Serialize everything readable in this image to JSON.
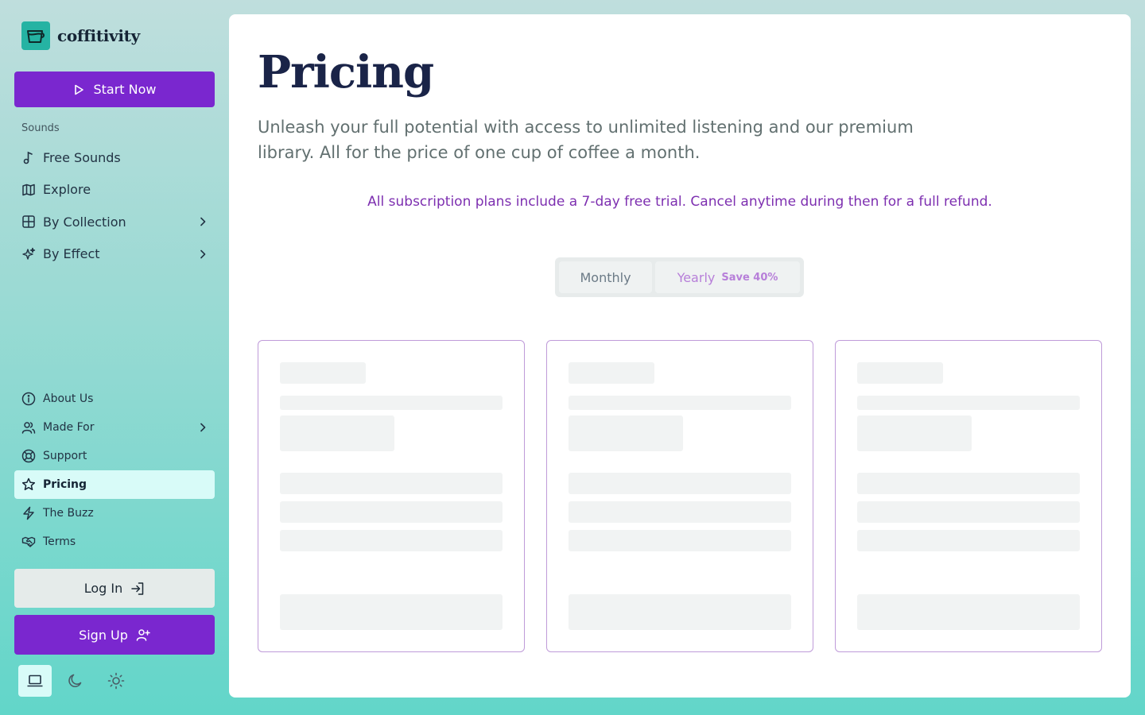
{
  "brand": {
    "name": "coffitivity",
    "logo_icon": "coffee-cup-icon"
  },
  "sidebar": {
    "start_button": "Start Now",
    "section_label": "Sounds",
    "top_items": [
      {
        "label": "Free Sounds",
        "icon": "music-note-icon"
      },
      {
        "label": "Explore",
        "icon": "map-icon"
      },
      {
        "label": "By Collection",
        "icon": "grid-icon"
      },
      {
        "label": "By Effect",
        "icon": "sparkles-icon"
      }
    ],
    "bottom_items": [
      {
        "label": "About Us",
        "icon": "info-icon"
      },
      {
        "label": "Made For",
        "icon": "users-icon"
      },
      {
        "label": "Support",
        "icon": "lifebuoy-icon"
      },
      {
        "label": "Pricing",
        "icon": "star-icon",
        "active": true
      },
      {
        "label": "The Buzz",
        "icon": "bolt-icon"
      },
      {
        "label": "Terms",
        "icon": "handshake-icon"
      }
    ],
    "login_button": "Log In",
    "signup_button": "Sign Up",
    "theme": {
      "selected": "system",
      "options": [
        "system",
        "dark",
        "light"
      ]
    }
  },
  "main": {
    "title": "Pricing",
    "intro": "Unleash your full potential with access to unlimited listening and our premium library. All for the price of one cup of coffee a month.",
    "trial_note": "All subscription plans include a 7-day free trial. Cancel anytime during then for a full refund.",
    "billing_toggle": {
      "monthly_label": "Monthly",
      "yearly_label": "Yearly",
      "yearly_badge": "Save 40%"
    },
    "plan_cards_loading": 3
  },
  "colors": {
    "accent_purple": "#7a27cf",
    "active_nav_bg": "#d8fbf8",
    "title_navy": "#1a2448",
    "note_purple": "#7d2fb0",
    "card_border": "#bf9bd9"
  }
}
